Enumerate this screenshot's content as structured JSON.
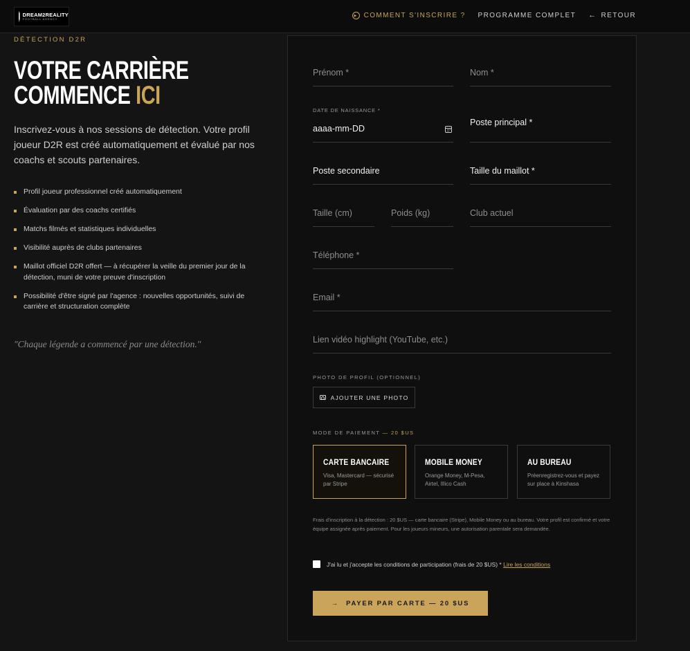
{
  "header": {
    "logo": {
      "name": "DREAM2REALITY",
      "tagline": "FOOTBALL AGENCY"
    },
    "nav": [
      {
        "label": "COMMENT S'INSCRIRE ?",
        "icon": "play-circle-icon"
      },
      {
        "label": "PROGRAMME COMPLET"
      },
      {
        "label": "RETOUR",
        "icon": "arrow-left-icon"
      }
    ],
    "accent": "#c9a45a"
  },
  "intro": {
    "kicker": "DÉTECTION D2R",
    "title_line1": "VOTRE CARRIÈRE",
    "title_line2_white": "COMMENCE",
    "title_line2_gold": "ICI",
    "lead": "Inscrivez-vous à nos sessions de détection. Votre profil joueur D2R est créé automatiquement et évalué par nos coachs et scouts partenaires.",
    "bullets": [
      "Profil joueur professionnel créé automatiquement",
      "Évaluation par des coachs certifiés",
      "Matchs filmés et statistiques individuelles",
      "Visibilité auprès de clubs partenaires",
      "Maillot officiel D2R offert — à récupérer la veille du premier jour de la détection, muni de votre preuve d'inscription",
      "Possibilité d'être signé par l'agence : nouvelles opportunités, suivi de carrière et structuration complète"
    ],
    "quote": "\"Chaque légende a commencé par une détection.\""
  },
  "form": {
    "prenom": {
      "placeholder": "Prénom *"
    },
    "nom": {
      "placeholder": "Nom *"
    },
    "dob": {
      "label": "DATE DE NAISSANCE *",
      "value": "aaaa-mm-DD"
    },
    "poste_principal": {
      "value": "Poste principal *"
    },
    "poste_secondaire": {
      "value": "Poste secondaire"
    },
    "taille_maillot": {
      "value": "Taille du maillot *"
    },
    "taille": {
      "placeholder": "Taille (cm)"
    },
    "poids": {
      "placeholder": "Poids (kg)"
    },
    "club": {
      "placeholder": "Club actuel"
    },
    "telephone": {
      "placeholder": "Téléphone *"
    },
    "email": {
      "placeholder": "Email *"
    },
    "video": {
      "placeholder": "Lien vidéo highlight (YouTube, etc.)"
    },
    "photo": {
      "label": "PHOTO DE PROFIL (OPTIONNEL)",
      "button": "AJOUTER UNE PHOTO"
    },
    "payment": {
      "label": "MODE DE PAIEMENT",
      "amount": "— 20 $US",
      "options": [
        {
          "title": "CARTE BANCAIRE",
          "desc": "Visa, Mastercard — sécurisé par Stripe",
          "selected": true
        },
        {
          "title": "MOBILE MONEY",
          "desc": "Orange Money, M-Pesa, Airtel, Illico Cash",
          "selected": false
        },
        {
          "title": "AU BUREAU",
          "desc": "Préenregistrez-vous et payez sur place à Kinshasa",
          "selected": false
        }
      ]
    },
    "info": "Frais d'inscription à la détection : 20 $US — carte bancaire (Stripe), Mobile Money ou au bureau. Votre profil est confirmé et votre équipe assignée après paiement. Pour les joueurs mineurs, une autorisation parentale sera demandée.",
    "consent": {
      "text": "J'ai lu et j'accepte les conditions de participation (frais de 20 $US) *",
      "link": "Lire les conditions"
    },
    "submit": "PAYER PAR CARTE — 20 $US"
  }
}
